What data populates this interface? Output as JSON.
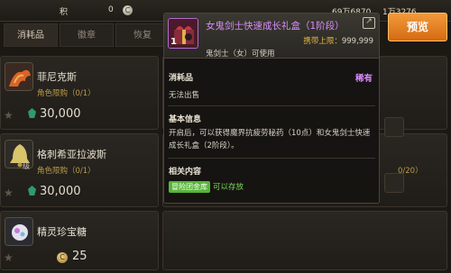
{
  "topbar": {
    "points_label": "积",
    "points_value": "0",
    "coin_symbol": "C",
    "gold_value": "1万3276",
    "cera_value": "69万6870"
  },
  "tabs": [
    {
      "label": "消耗品"
    },
    {
      "label": "徽章"
    },
    {
      "label": "恢复"
    },
    {
      "label": ""
    }
  ],
  "items": [
    {
      "name": "菲尼克斯",
      "limit": "角色限购（0/1）",
      "price": "30,000",
      "currency": "gem-icon",
      "level_tag": ""
    },
    {
      "name": "格刺希亚拉波斯",
      "limit": "角色限购（0/1）",
      "price": "30,000",
      "currency": "gem-icon",
      "level_tag": "级"
    },
    {
      "name": "精灵珍宝糖",
      "limit": "",
      "price": "25",
      "currency": "gold-coin-icon",
      "level_tag": ""
    }
  ],
  "right_partial": {
    "limit_fragment": "0/20）"
  },
  "buttons": {
    "preview": "预览"
  },
  "tooltip": {
    "title": "女鬼剑士快速成长礼盒（1阶段）",
    "count_badge": "1",
    "limit_label": "携带上限：",
    "limit_value": "999,999",
    "class_req": "鬼剑士（女）可使用",
    "category": "消耗品",
    "rarity": "稀有",
    "sell_note": "无法出售",
    "basic_info_label": "基本信息",
    "description": "开启后，可以获得魔界抗疲劳秘药（10点）和女鬼剑士快速成长礼盒（2阶段）。",
    "related_label": "相关内容",
    "storage_tag": "冒险团金库",
    "storage_text": "可以存放"
  },
  "colors": {
    "accent_orange": "#e07e22",
    "rare_purple": "#d98cff",
    "limit_gold": "#e7b63f",
    "storage_green": "#57b43a"
  }
}
